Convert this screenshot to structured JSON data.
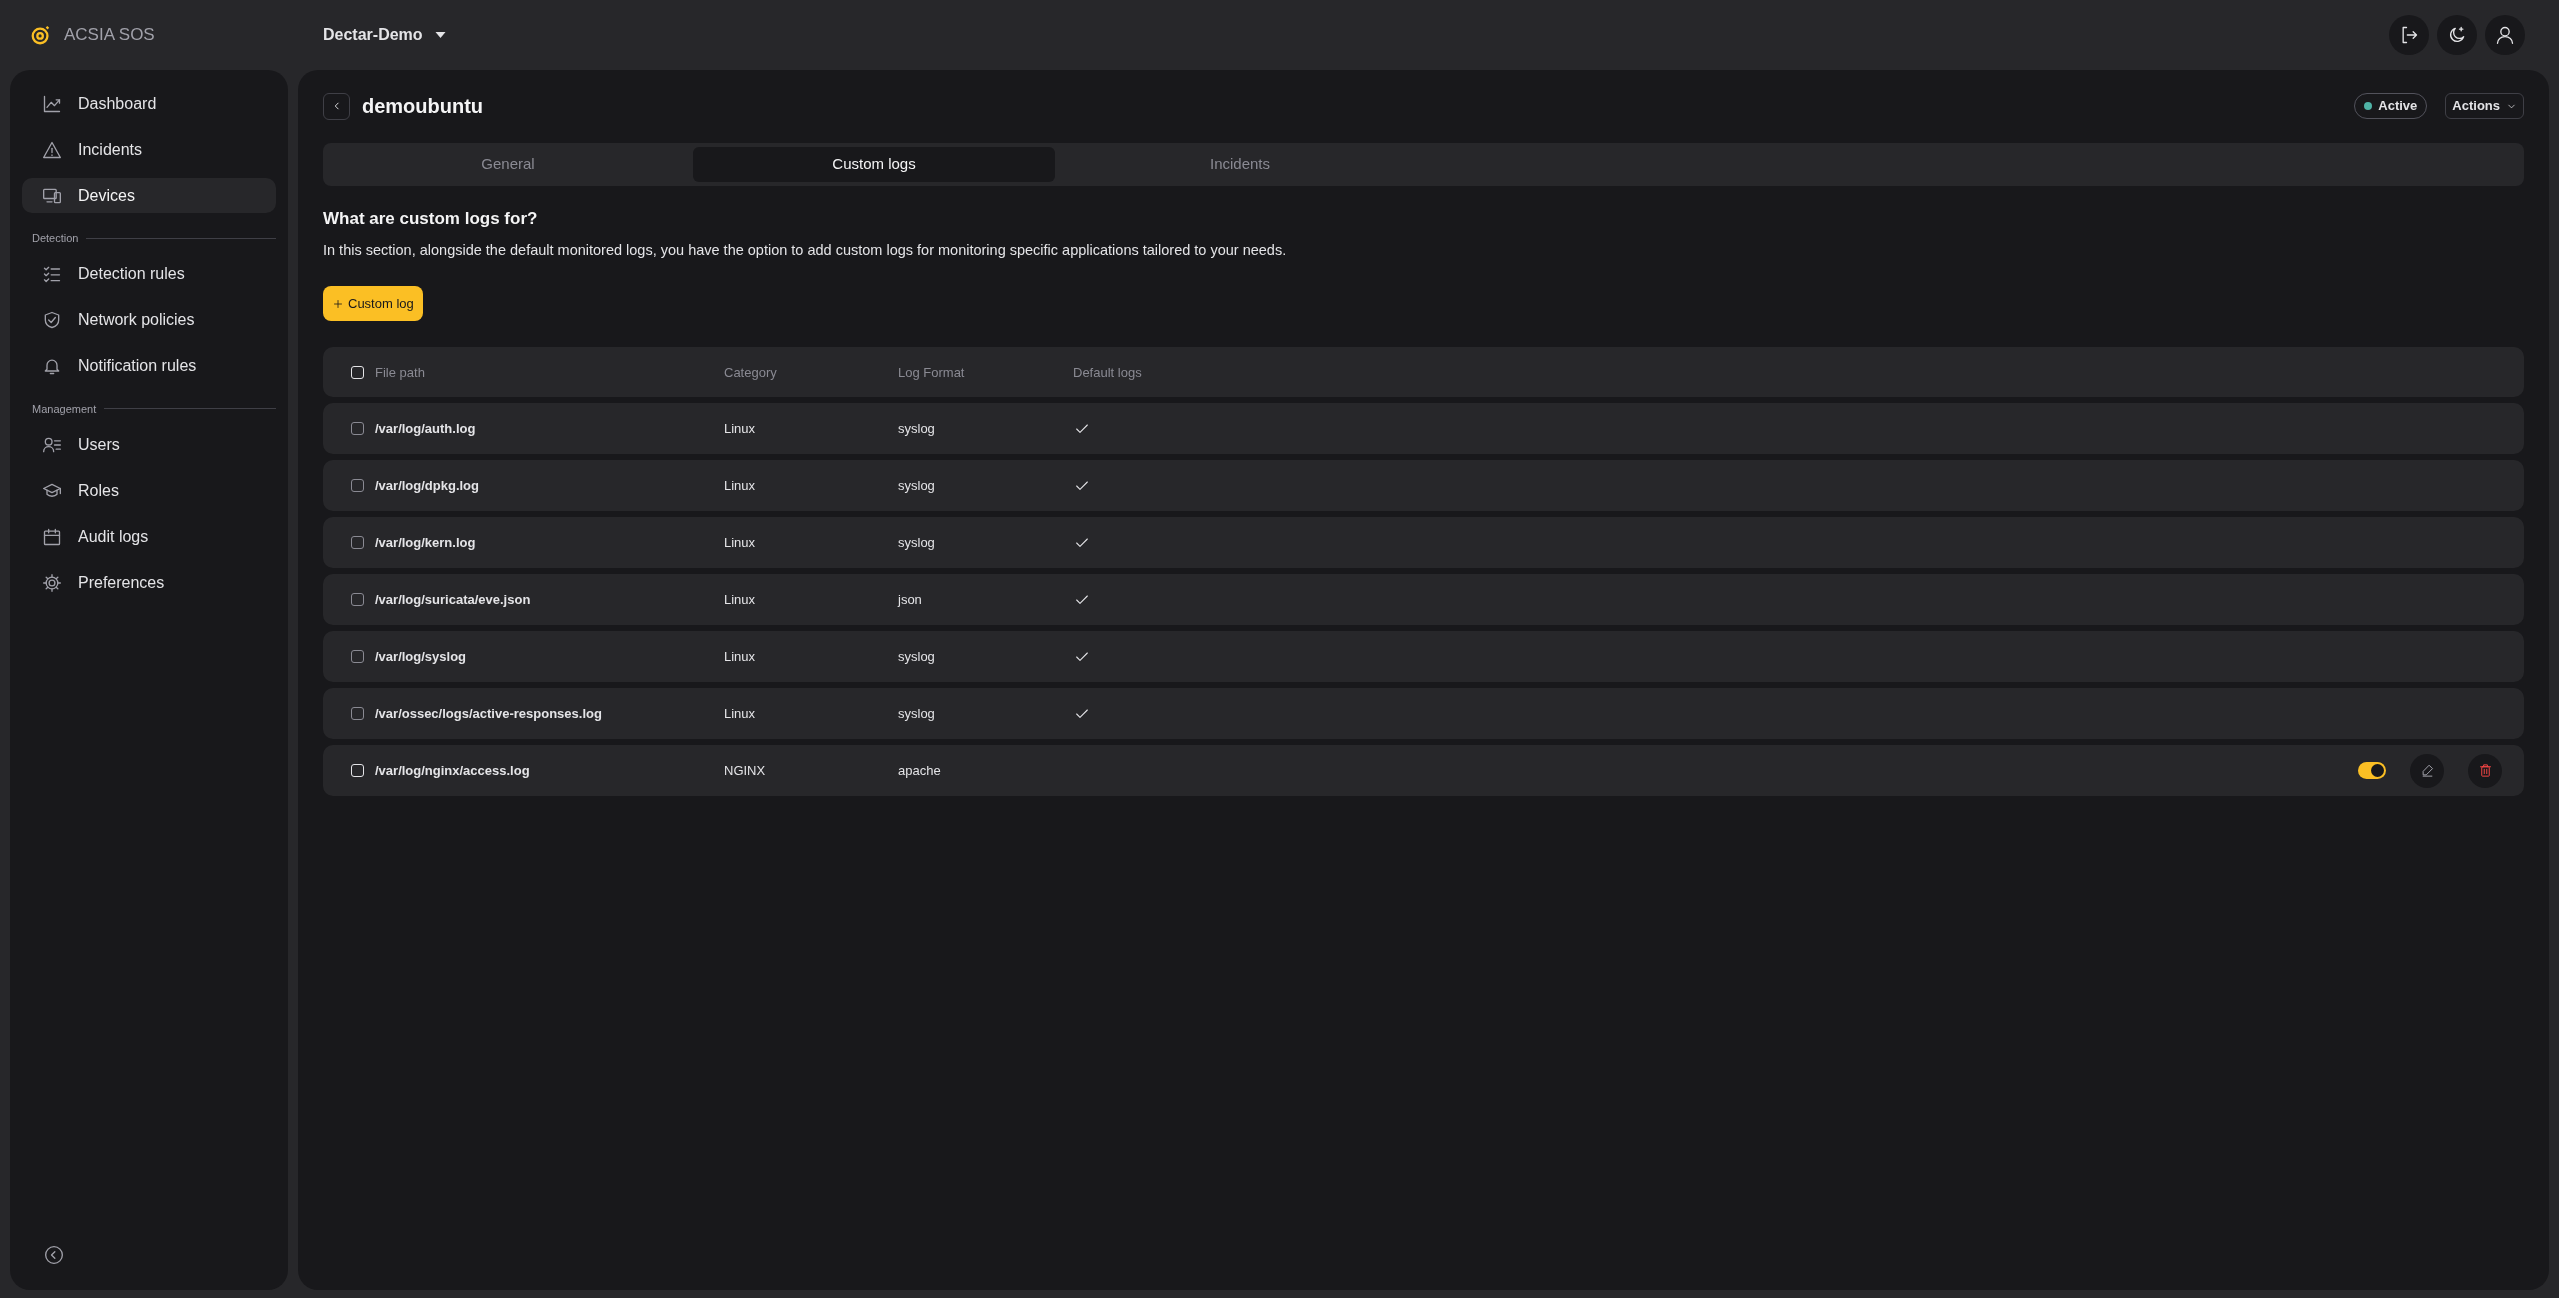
{
  "app": {
    "name": "ACSIA SOS",
    "workspace": "Dectar-Demo"
  },
  "sidebar": {
    "groups": [
      {
        "items": [
          {
            "label": "Dashboard",
            "selected": false
          },
          {
            "label": "Incidents",
            "selected": false
          },
          {
            "label": "Devices",
            "selected": true
          }
        ]
      },
      {
        "label": "Detection",
        "items": [
          {
            "label": "Detection rules",
            "selected": false
          },
          {
            "label": "Network policies",
            "selected": false
          },
          {
            "label": "Notification rules",
            "selected": false
          }
        ]
      },
      {
        "label": "Management",
        "items": [
          {
            "label": "Users",
            "selected": false
          },
          {
            "label": "Roles",
            "selected": false
          },
          {
            "label": "Audit logs",
            "selected": false
          },
          {
            "label": "Preferences",
            "selected": false
          }
        ]
      }
    ]
  },
  "device": {
    "name": "demoubuntu",
    "status": "Active",
    "actions": "Actions"
  },
  "tabs": [
    {
      "label": "General",
      "selected": false
    },
    {
      "label": "Custom logs",
      "selected": true
    },
    {
      "label": "Incidents",
      "selected": false
    }
  ],
  "section": {
    "title": "What are custom logs for?",
    "text": "In this section, alongside the default monitored logs, you have the option to add custom logs for monitoring specific applications tailored to your needs.",
    "add_button": "Custom log"
  },
  "table": {
    "columns": [
      "File path",
      "Category",
      "Log Format",
      "Default logs"
    ],
    "all_checked": false,
    "rows": [
      {
        "path": "/var/log/auth.log",
        "category": "Linux",
        "format": "syslog",
        "default_log": true,
        "checked": false
      },
      {
        "path": "/var/log/dpkg.log",
        "category": "Linux",
        "format": "syslog",
        "default_log": true,
        "checked": false
      },
      {
        "path": "/var/log/kern.log",
        "category": "Linux",
        "format": "syslog",
        "default_log": true,
        "checked": false
      },
      {
        "path": "/var/log/suricata/eve.json",
        "category": "Linux",
        "format": "json",
        "default_log": true,
        "checked": false
      },
      {
        "path": "/var/log/syslog",
        "category": "Linux",
        "format": "syslog",
        "default_log": true,
        "checked": false
      },
      {
        "path": "/var/ossec/logs/active-responses.log",
        "category": "Linux",
        "format": "syslog",
        "default_log": true,
        "checked": false
      },
      {
        "path": "/var/log/nginx/access.log",
        "category": "NGINX",
        "format": "apache",
        "default_log": false,
        "enabled": true,
        "checked": false
      }
    ]
  }
}
